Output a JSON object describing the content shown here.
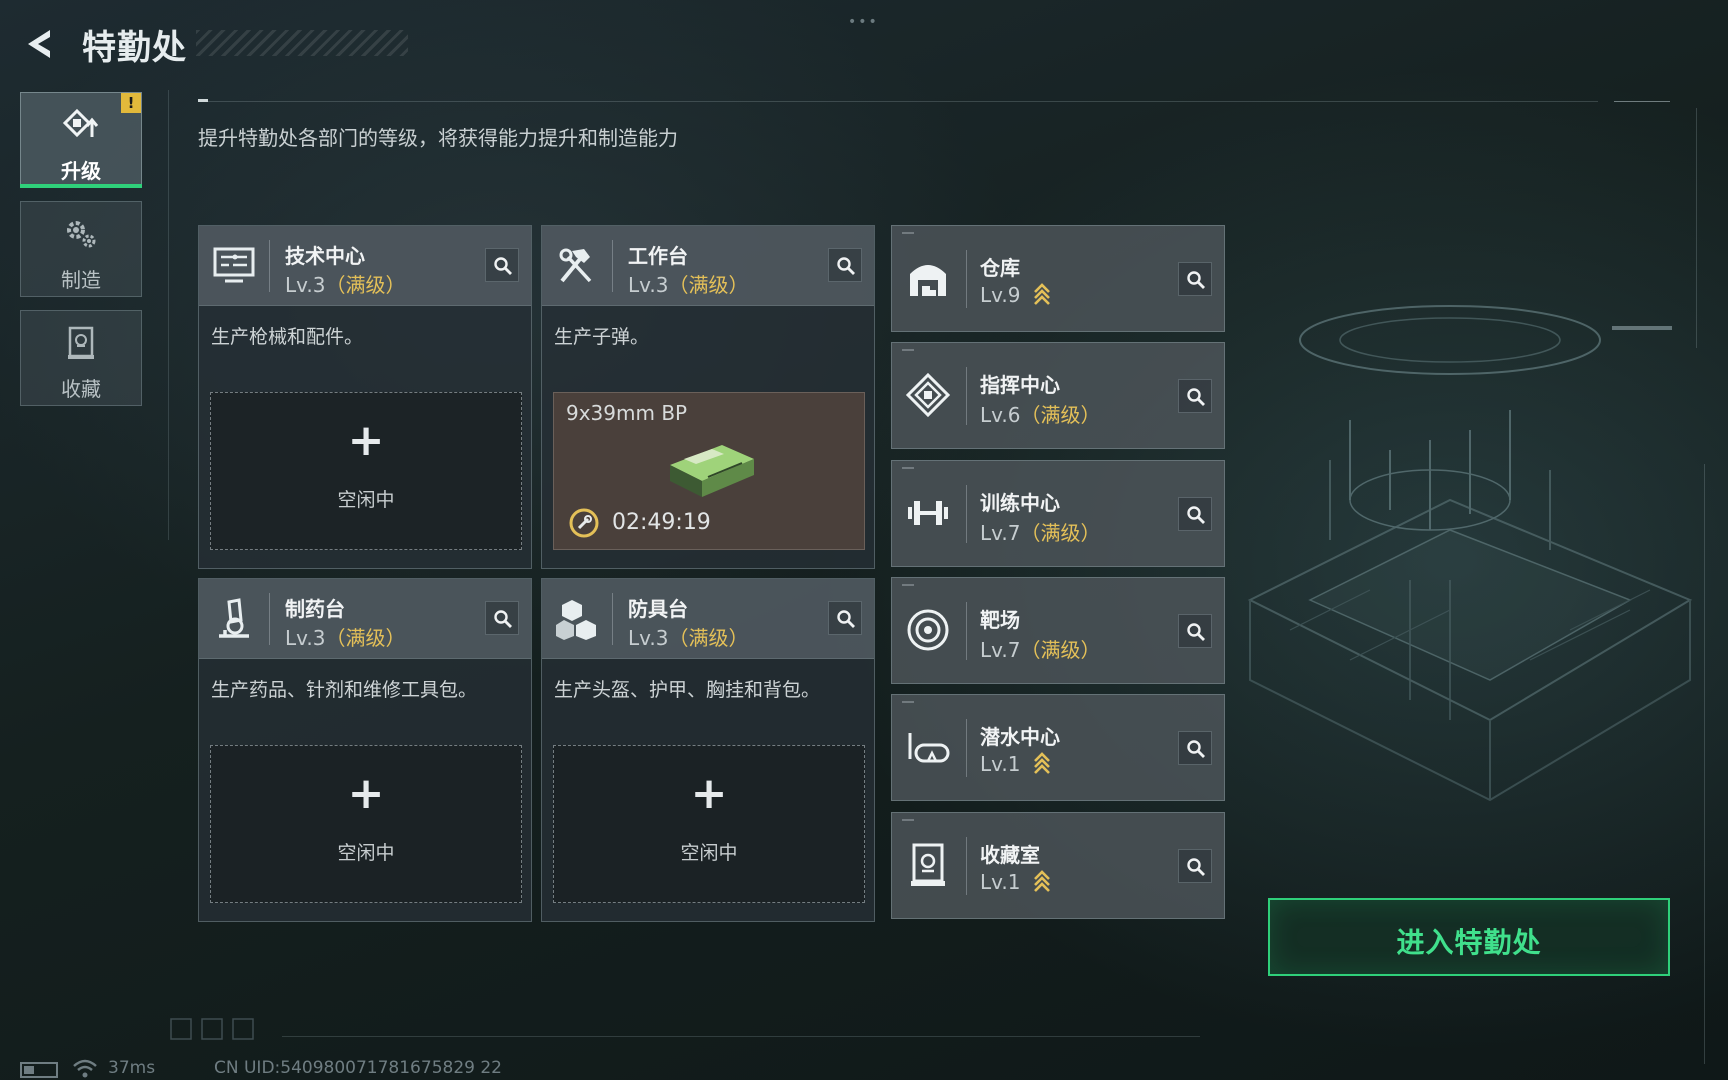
{
  "header": {
    "title": "特勤处",
    "subtitle": "提升特勤处各部门的等级，将获得能力提升和制造能力"
  },
  "sidebar": {
    "items": [
      {
        "label": "升级",
        "icon": "upgrade-icon",
        "active": true,
        "alert": "!"
      },
      {
        "label": "制造",
        "icon": "gears-icon",
        "active": false
      },
      {
        "label": "收藏",
        "icon": "collection-icon",
        "active": false
      }
    ]
  },
  "facilities": {
    "tech_center": {
      "name": "技术中心",
      "level": "Lv.3",
      "max_tag": "（满级）",
      "desc": "生产枪械和配件。",
      "slot_plus": "+",
      "slot_status": "空闲中",
      "icon": "monitor-icon"
    },
    "workbench": {
      "name": "工作台",
      "level": "Lv.3",
      "max_tag": "（满级）",
      "desc": "生产子弹。",
      "craft_item": "9x39mm BP",
      "craft_timer": "02:49:19",
      "icon": "hammer-wrench-icon"
    },
    "pharmacy": {
      "name": "制药台",
      "level": "Lv.3",
      "max_tag": "（满级）",
      "desc": "生产药品、针剂和维修工具包。",
      "slot_plus": "+",
      "slot_status": "空闲中",
      "icon": "microscope-icon"
    },
    "armor_bench": {
      "name": "防具台",
      "level": "Lv.3",
      "max_tag": "（满级）",
      "desc": "生产头盔、护甲、胸挂和背包。",
      "slot_plus": "+",
      "slot_status": "空闲中",
      "icon": "cubes-icon"
    }
  },
  "rooms": [
    {
      "name": "仓库",
      "level": "Lv.9",
      "max_tag": "",
      "upgradable": true,
      "icon": "warehouse-icon"
    },
    {
      "name": "指挥中心",
      "level": "Lv.6",
      "max_tag": "（满级）",
      "upgradable": false,
      "icon": "command-chip-icon"
    },
    {
      "name": "训练中心",
      "level": "Lv.7",
      "max_tag": "（满级）",
      "upgradable": false,
      "icon": "dumbbell-icon"
    },
    {
      "name": "靶场",
      "level": "Lv.7",
      "max_tag": "（满级）",
      "upgradable": false,
      "icon": "target-icon"
    },
    {
      "name": "潜水中心",
      "level": "Lv.1",
      "max_tag": "",
      "upgradable": true,
      "icon": "diving-mask-icon"
    },
    {
      "name": "收藏室",
      "level": "Lv.1",
      "max_tag": "",
      "upgradable": true,
      "icon": "collection-room-icon"
    }
  ],
  "enter_button": "进入特勤处",
  "status": {
    "ping": "37ms",
    "uid": "CN UID:540980071781675829 22"
  },
  "colors": {
    "accent_green": "#2fd07a",
    "max_level_gold": "#e4c058",
    "alert_yellow": "#e2b93b"
  }
}
